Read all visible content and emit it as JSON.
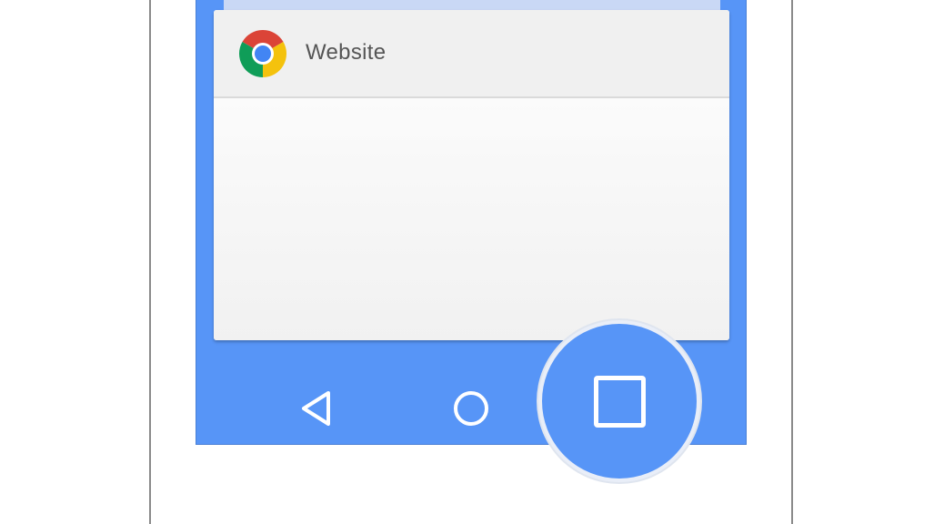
{
  "recents": {
    "cards": [
      {
        "app_icon": "chrome-icon",
        "title": "Website"
      }
    ]
  },
  "navigation": {
    "buttons": [
      {
        "icon": "back-triangle-icon"
      },
      {
        "icon": "home-circle-icon"
      },
      {
        "icon": "recents-square-icon",
        "highlighted": true
      }
    ]
  },
  "colors": {
    "screen_background": "#5795f7",
    "card_background": "#f5f5f5",
    "card_header": "#f0f0f0",
    "title_text": "#555555",
    "nav_icons": "#ffffff",
    "chrome_red": "#db4437",
    "chrome_yellow": "#f4c20d",
    "chrome_green": "#0f9d58",
    "chrome_blue": "#4285f4"
  }
}
